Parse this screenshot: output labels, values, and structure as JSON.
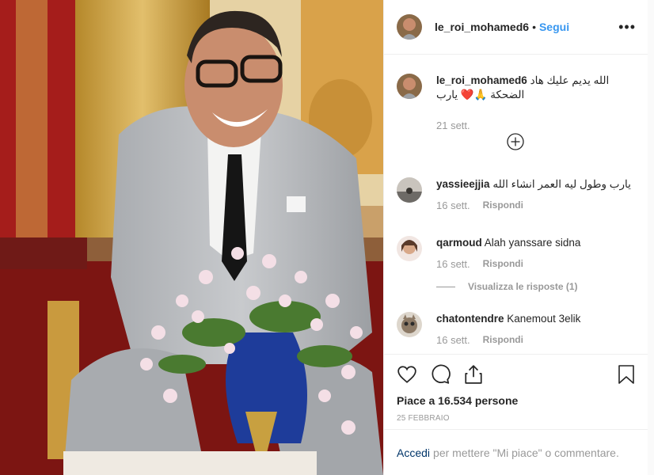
{
  "post": {
    "username": "le_roi_mohamed6",
    "separator": "•",
    "follow_label": "Segui",
    "more_icon": "•••"
  },
  "caption": {
    "username": "le_roi_mohamed6",
    "text": "الله يديم عليك هاد الضحكة 🙏❤️ يارب",
    "time": "21 sett."
  },
  "comments": [
    {
      "username": "yassieejjia",
      "text": "يارب وطول ليه العمر انشاء الله",
      "time": "16 sett.",
      "reply": "Rispondi"
    },
    {
      "username": "qarmoud",
      "text": "Alah yanssare sidna",
      "time": "16 sett.",
      "reply": "Rispondi"
    },
    {
      "username": "chatontendre",
      "text": "Kanemout 3elik",
      "time": "16 sett.",
      "reply": "Rispondi"
    }
  ],
  "view_replies": "Visualizza le risposte (1)",
  "likes_text": "Piace a 16.534 persone",
  "date_text": "25 FEBBRAIO",
  "login": {
    "link": "Accedi",
    "rest": "per mettere \"Mi piace\" o commentare."
  },
  "colors": {
    "link": "#3897f0",
    "text": "#262626",
    "muted": "#999999"
  }
}
